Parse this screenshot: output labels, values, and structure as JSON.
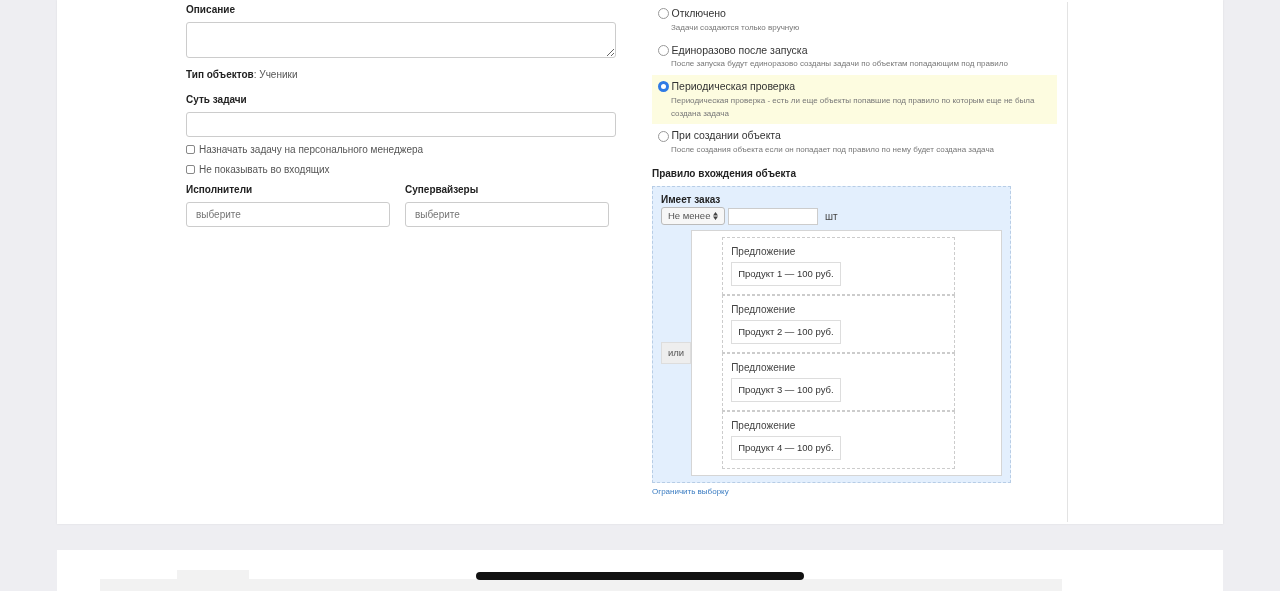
{
  "left": {
    "description_label": "Описание",
    "object_type_text": "**Тип объектов**: Ученики",
    "task_label": "Суть задачи",
    "checkboxes": [
      {
        "label": "Назначать задачу на персонального менеджера",
        "checked": false
      },
      {
        "label": "Не показывать во входящих",
        "checked": false
      }
    ],
    "pickers": [
      {
        "label": "Исполнители",
        "placeholder": "выберите"
      },
      {
        "label": "Супервайзеры",
        "placeholder": "выберите"
      }
    ]
  },
  "right": {
    "modes": [
      {
        "label": "Отключено",
        "hint": "Задачи создаются только вручную",
        "selected": false
      },
      {
        "label": "Единоразово после запуска",
        "hint": "После запуска будут единоразово созданы задачи по объектам попадающим под правило",
        "selected": false
      },
      {
        "label": "Периодическая проверка",
        "hint": "Периодическая проверка - есть ли еще объекты попавшие под правило по которым еще не была создана задача",
        "selected": true
      },
      {
        "label": "При создании объекта",
        "hint": "После создания объекта если он попадает под правило по нему будет создана задача",
        "selected": false
      }
    ],
    "rule_label": "Правило вхождения объекта",
    "rule": {
      "title": "Имеет заказ",
      "comparator": "Не менее",
      "unit": "шт",
      "or_label": "или",
      "offers": [
        {
          "label": "Предложение",
          "product": "Продукт 1 — 100 руб."
        },
        {
          "label": "Предложение",
          "product": "Продукт 2 — 100 руб."
        },
        {
          "label": "Предложение",
          "product": "Продукт 3 — 100 руб."
        },
        {
          "label": "Предложение",
          "product": "Продукт 4 — 100 руб."
        }
      ]
    },
    "limit_link": "Ограничить выборку"
  }
}
